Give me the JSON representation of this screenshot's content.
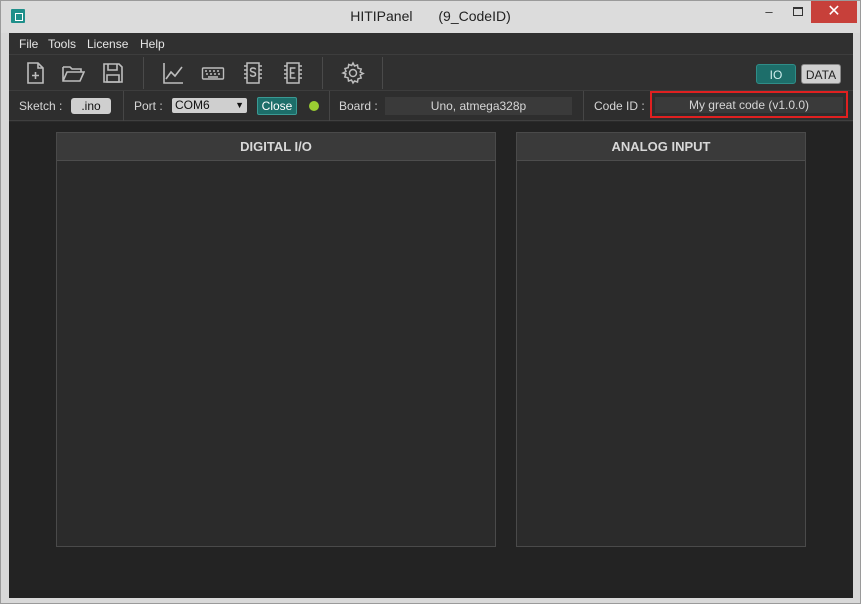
{
  "window": {
    "title": "HITIPanel",
    "subtitle": "(9_CodeID)",
    "controls": {
      "minimize": "–",
      "close": "✕"
    }
  },
  "menu": {
    "items": [
      "File",
      "Tools",
      "License",
      "Help"
    ]
  },
  "toolbar": {
    "icons": [
      "new-file-icon",
      "open-folder-icon",
      "save-icon",
      "chart-icon",
      "keyboard-icon",
      "s-chip-icon",
      "e-chip-icon",
      "gear-icon"
    ],
    "mode_io": "IO",
    "mode_data": "DATA"
  },
  "infobar": {
    "sketch_label": "Sketch :",
    "sketch_value": ".ino",
    "port_label": "Port :",
    "port_value": "COM6",
    "close_label": "Close",
    "board_label": "Board :",
    "board_value": "Uno, atmega328p",
    "codeid_label": "Code ID :",
    "codeid_value": "My great code  (v1.0.0)"
  },
  "panels": {
    "digital": "DIGITAL  I/O",
    "analog": "ANALOG  INPUT"
  },
  "colors": {
    "accent": "#1d6e6a",
    "led": "#9acd32",
    "highlight": "#e02020",
    "close": "#c7403a"
  }
}
